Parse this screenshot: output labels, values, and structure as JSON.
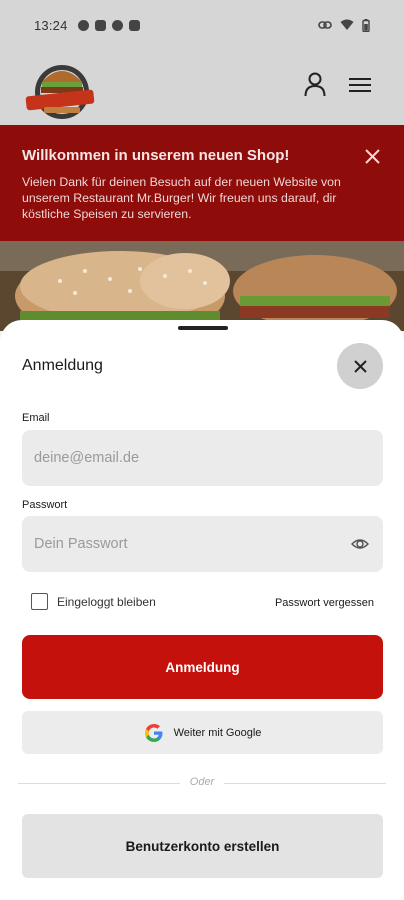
{
  "status_bar": {
    "time": "13:24"
  },
  "banner": {
    "title": "Willkommen in unserem neuen Shop!",
    "text": "Vielen Dank für deinen Besuch auf der neuen Website von unserem Restaurant Mr.Burger! Wir freuen uns darauf, dir köstliche Speisen zu servieren."
  },
  "login": {
    "title": "Anmeldung",
    "email_label": "Email",
    "email_placeholder": "deine@email.de",
    "password_label": "Passwort",
    "password_placeholder": "Dein Passwort",
    "remember_label": "Eingeloggt bleiben",
    "remember_checked": false,
    "forgot_label": "Passwort vergessen",
    "submit_label": "Anmeldung",
    "google_label": "Weiter mit Google",
    "divider_label": "Oder",
    "create_account_label": "Benutzerkonto erstellen"
  },
  "colors": {
    "primary": "#c4110b",
    "banner_bg": "#8e0d0a"
  },
  "icons": [
    "account-icon",
    "menu-icon",
    "close-icon",
    "eye-icon",
    "google-icon"
  ]
}
